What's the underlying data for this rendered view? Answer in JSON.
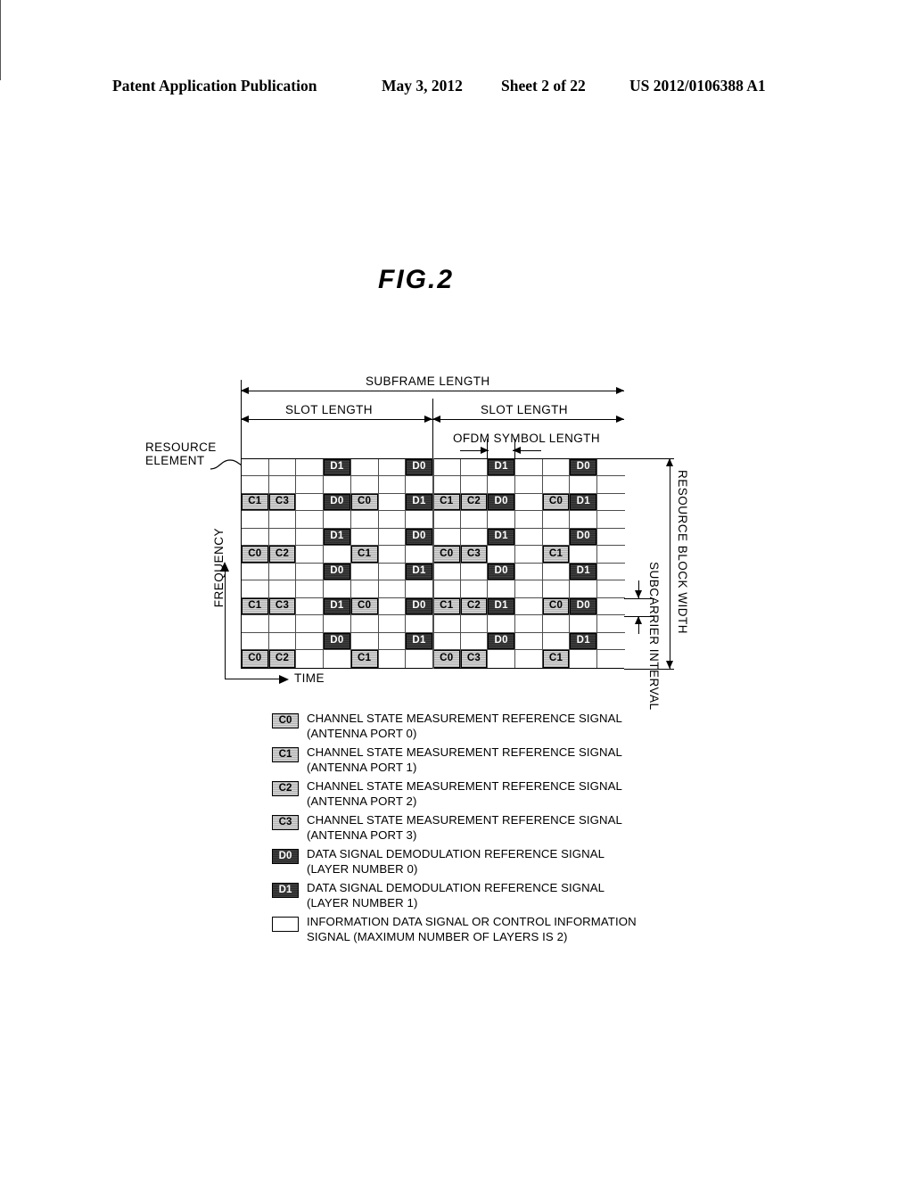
{
  "header": {
    "publication": "Patent Application Publication",
    "date": "May 3, 2012",
    "sheet": "Sheet 2 of 22",
    "number": "US 2012/0106388 A1"
  },
  "figure": {
    "title": "FIG.2",
    "dimensions": {
      "subframe_length": "SUBFRAME LENGTH",
      "slot_length_left": "SLOT LENGTH",
      "slot_length_right": "SLOT LENGTH",
      "ofdm_symbol_length": "OFDM SYMBOL LENGTH",
      "resource_block_width": "RESOURCE BLOCK WIDTH",
      "subcarrier_interval": "SUBCARRIER INTERVAL"
    },
    "axes": {
      "frequency": "FREQUENCY",
      "time": "TIME"
    },
    "callout": {
      "resource_element_line1": "RESOURCE",
      "resource_element_line2": "ELEMENT"
    }
  },
  "grid": {
    "columns": 14,
    "rows": 12,
    "cells": [
      [
        "",
        "",
        "",
        "D1",
        "",
        "",
        "D0",
        "",
        "",
        "D1",
        "",
        "",
        "D0",
        ""
      ],
      [
        "",
        "",
        "",
        "",
        "",
        "",
        "",
        "",
        "",
        "",
        "",
        "",
        "",
        ""
      ],
      [
        "C1",
        "C3",
        "",
        "D0",
        "C0",
        "",
        "D1",
        "C1",
        "C2",
        "D0",
        "",
        "C0",
        "D1",
        ""
      ],
      [
        "",
        "",
        "",
        "",
        "",
        "",
        "",
        "",
        "",
        "",
        "",
        "",
        "",
        ""
      ],
      [
        "",
        "",
        "",
        "D1",
        "",
        "",
        "D0",
        "",
        "",
        "D1",
        "",
        "",
        "D0",
        ""
      ],
      [
        "C0",
        "C2",
        "",
        "",
        "C1",
        "",
        "",
        "C0",
        "C3",
        "",
        "",
        "C1",
        "",
        ""
      ],
      [
        "",
        "",
        "",
        "D0",
        "",
        "",
        "D1",
        "",
        "",
        "D0",
        "",
        "",
        "D1",
        ""
      ],
      [
        "",
        "",
        "",
        "",
        "",
        "",
        "",
        "",
        "",
        "",
        "",
        "",
        "",
        ""
      ],
      [
        "C1",
        "C3",
        "",
        "D1",
        "C0",
        "",
        "D0",
        "C1",
        "C2",
        "D1",
        "",
        "C0",
        "D0",
        ""
      ],
      [
        "",
        "",
        "",
        "",
        "",
        "",
        "",
        "",
        "",
        "",
        "",
        "",
        "",
        ""
      ],
      [
        "",
        "",
        "",
        "D0",
        "",
        "",
        "D1",
        "",
        "",
        "D0",
        "",
        "",
        "D1",
        ""
      ],
      [
        "C0",
        "C2",
        "",
        "",
        "C1",
        "",
        "",
        "C0",
        "C3",
        "",
        "",
        "C1",
        "",
        ""
      ]
    ]
  },
  "legend": {
    "items": [
      {
        "symbol": "C0",
        "kind": "c",
        "line1": "CHANNEL STATE MEASUREMENT REFERENCE SIGNAL",
        "line2": "(ANTENNA PORT 0)"
      },
      {
        "symbol": "C1",
        "kind": "c",
        "line1": "CHANNEL STATE MEASUREMENT REFERENCE SIGNAL",
        "line2": "(ANTENNA PORT 1)"
      },
      {
        "symbol": "C2",
        "kind": "c",
        "line1": "CHANNEL STATE MEASUREMENT REFERENCE SIGNAL",
        "line2": "(ANTENNA PORT 2)"
      },
      {
        "symbol": "C3",
        "kind": "c",
        "line1": "CHANNEL STATE MEASUREMENT REFERENCE SIGNAL",
        "line2": "(ANTENNA PORT 3)"
      },
      {
        "symbol": "D0",
        "kind": "d",
        "line1": "DATA SIGNAL DEMODULATION REFERENCE SIGNAL",
        "line2": "(LAYER NUMBER 0)"
      },
      {
        "symbol": "D1",
        "kind": "d",
        "line1": "DATA SIGNAL DEMODULATION REFERENCE SIGNAL",
        "line2": "(LAYER NUMBER 1)"
      },
      {
        "symbol": "",
        "kind": "blank",
        "line1": "INFORMATION DATA SIGNAL OR CONTROL INFORMATION",
        "line2": "SIGNAL (MAXIMUM NUMBER OF LAYERS IS 2)"
      }
    ]
  }
}
